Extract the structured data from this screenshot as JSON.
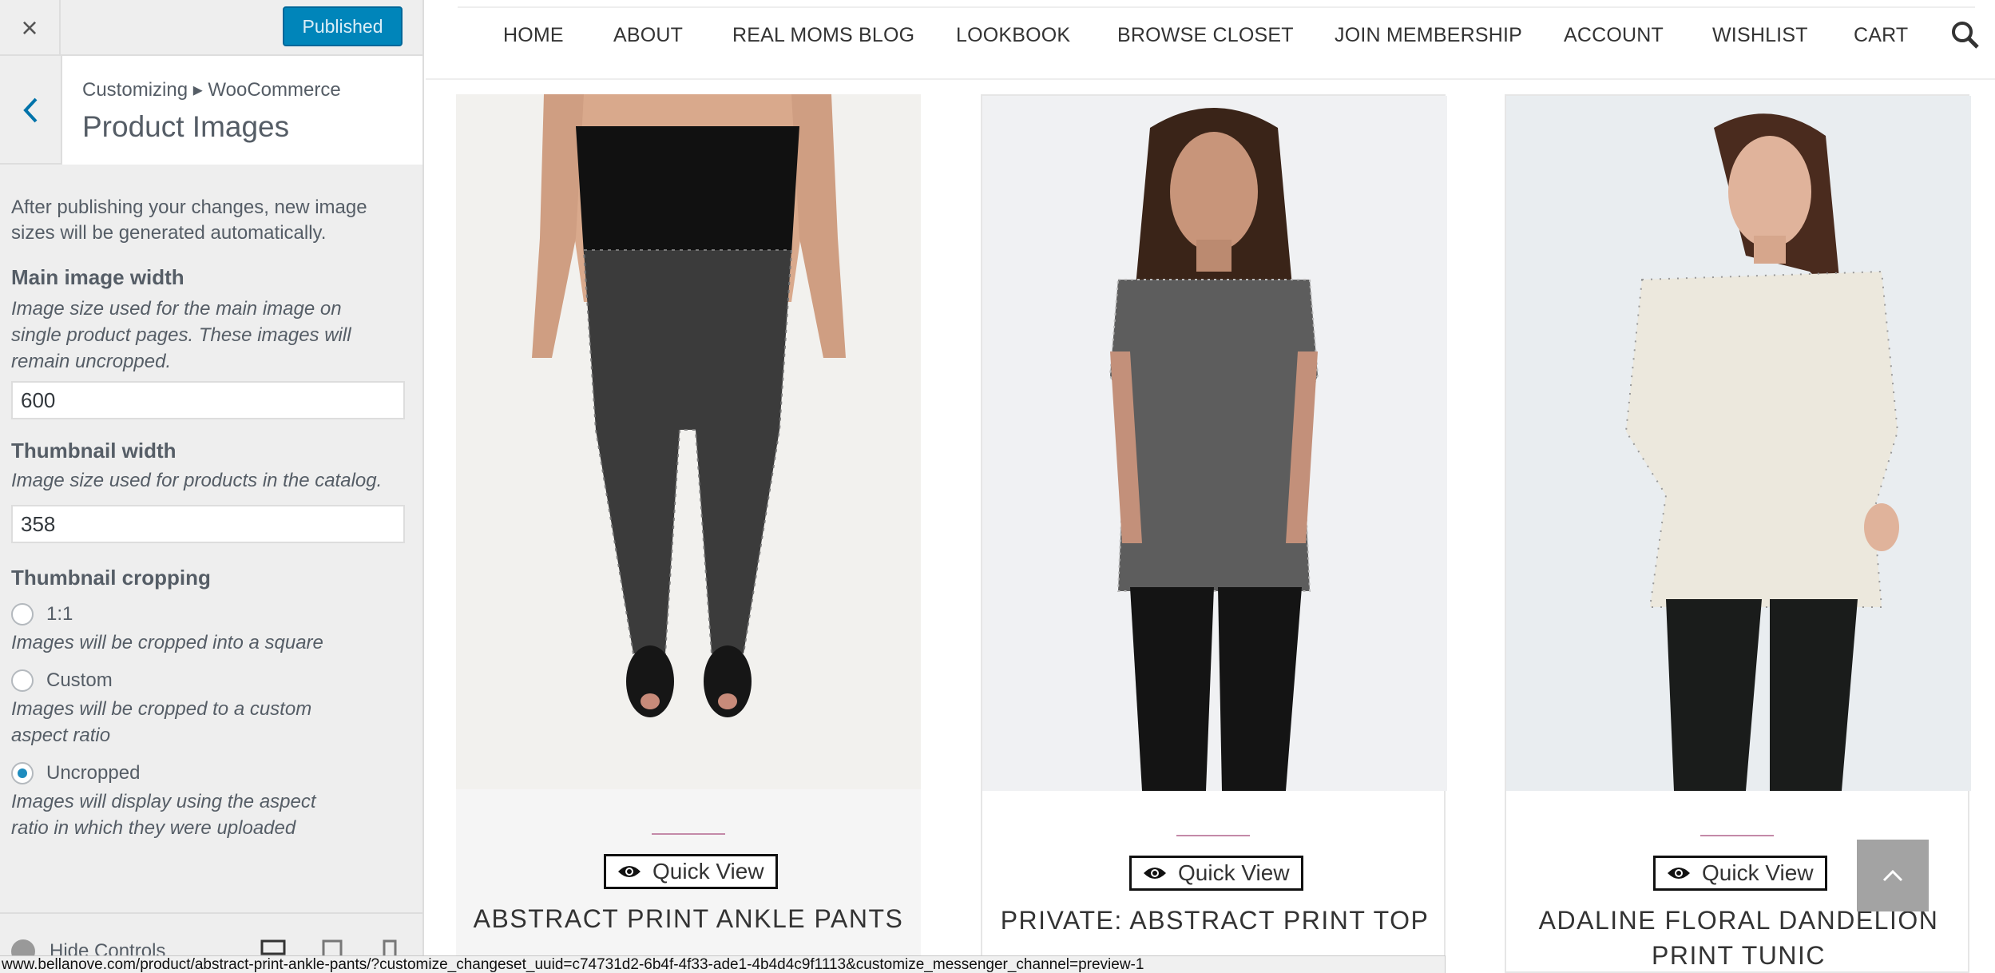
{
  "customizer": {
    "close_label": "×",
    "publish_label": "Published",
    "breadcrumb": "Customizing ▸ WooCommerce",
    "panel_title": "Product Images",
    "intro": "After publishing your changes, new image sizes will be generated automatically.",
    "main_width": {
      "title": "Main image width",
      "description": "Image size used for the main image on single product pages. These images will remain uncropped.",
      "value": "600"
    },
    "thumb_width": {
      "title": "Thumbnail width",
      "description": "Image size used for products in the catalog.",
      "value": "358"
    },
    "cropping": {
      "title": "Thumbnail cropping",
      "options": [
        {
          "label": "1:1",
          "description": "Images will be cropped into a square",
          "checked": false
        },
        {
          "label": "Custom",
          "description": "Images will be cropped to a custom aspect ratio",
          "checked": false
        },
        {
          "label": "Uncropped",
          "description": "Images will display using the aspect ratio in which they were uploaded",
          "checked": true
        }
      ]
    },
    "footer": {
      "hide_label": "Hide Controls"
    },
    "colors": {
      "publish_bg": "#0085ba",
      "radio_checked": "#1e8cbe"
    }
  },
  "site_nav": {
    "items": [
      "HOME",
      "ABOUT",
      "REAL MOMS BLOG",
      "LOOKBOOK",
      "BROWSE CLOSET",
      "JOIN MEMBERSHIP",
      "ACCOUNT",
      "WISHLIST",
      "CART"
    ],
    "search_icon": "search-icon"
  },
  "products": [
    {
      "title": "ABSTRACT PRINT ANKLE PANTS",
      "quick_view": "Quick View"
    },
    {
      "title": "PRIVATE: ABSTRACT PRINT TOP",
      "quick_view": "Quick View"
    },
    {
      "title": "ADALINE FLORAL DANDELION PRINT TUNIC",
      "quick_view": "Quick View"
    }
  ],
  "status_url": "www.bellanove.com/product/abstract-print-ankle-pants/?customize_changeset_uuid=c74731d2-6b4f-4f33-ade1-4b4d4c9f1113&customize_messenger_channel=preview-1"
}
